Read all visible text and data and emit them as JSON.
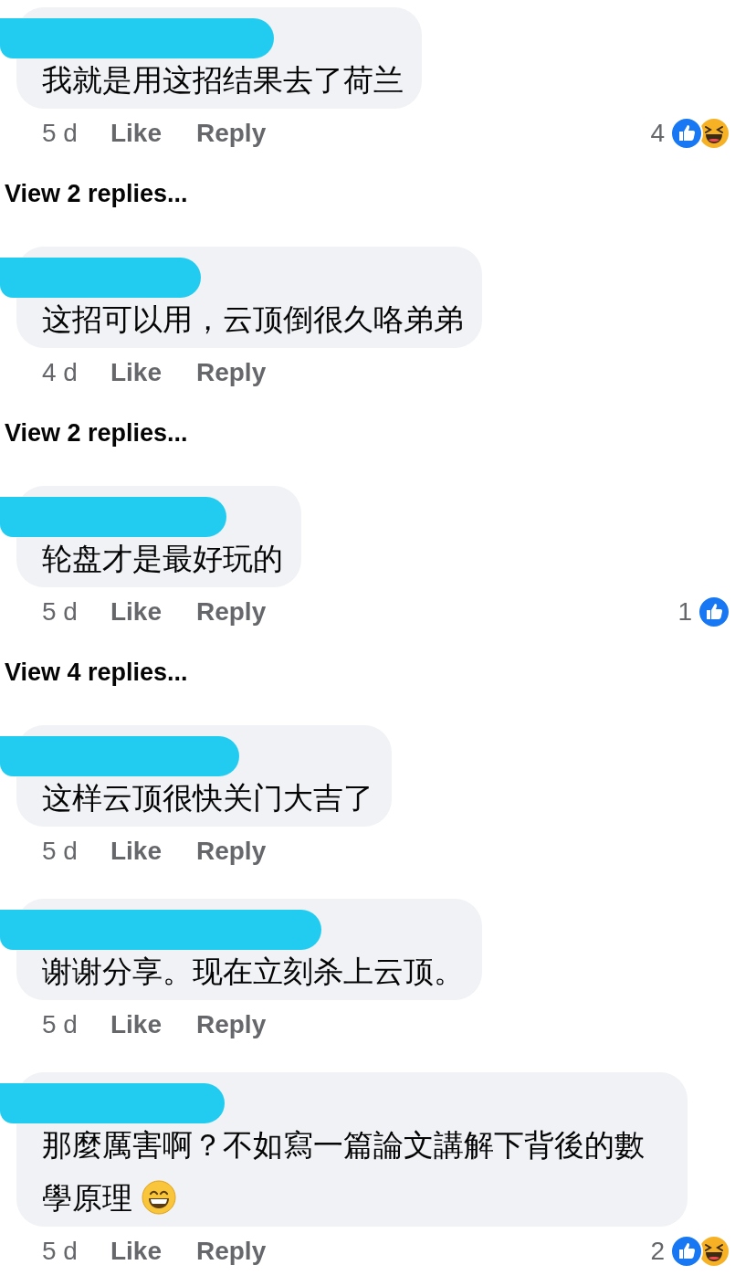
{
  "comments": [
    {
      "name_redacted": true,
      "text": "我就是用这招结果去了荷兰",
      "time": "5 d",
      "like": "Like",
      "reply": "Reply",
      "reactions": {
        "count": "4",
        "icons": [
          {
            "kind": "like"
          },
          {
            "kind": "haha"
          }
        ]
      },
      "view_replies": "View 2 replies..."
    },
    {
      "name_redacted": true,
      "text": "这招可以用，云顶倒很久咯弟弟",
      "time": "4 d",
      "like": "Like",
      "reply": "Reply",
      "view_replies": "View 2 replies..."
    },
    {
      "name_redacted": true,
      "text": "轮盘才是最好玩的",
      "time": "5 d",
      "like": "Like",
      "reply": "Reply",
      "reactions": {
        "count": "1",
        "icons": [
          {
            "kind": "like"
          }
        ]
      },
      "view_replies": "View 4 replies..."
    },
    {
      "name_redacted": true,
      "text": "这样云顶很快关门大吉了",
      "time": "5 d",
      "like": "Like",
      "reply": "Reply"
    },
    {
      "name_redacted": true,
      "text": "谢谢分享。现在立刻杀上云顶。",
      "time": "5 d",
      "like": "Like",
      "reply": "Reply"
    },
    {
      "name_redacted": true,
      "text": "那麼厲害啊？不如寫一篇論文講解下背後的數學原理",
      "emoji": {
        "kind": "grin"
      },
      "time": "5 d",
      "like": "Like",
      "reply": "Reply",
      "reactions": {
        "count": "2",
        "icons": [
          {
            "kind": "like"
          },
          {
            "kind": "haha"
          }
        ]
      }
    }
  ]
}
